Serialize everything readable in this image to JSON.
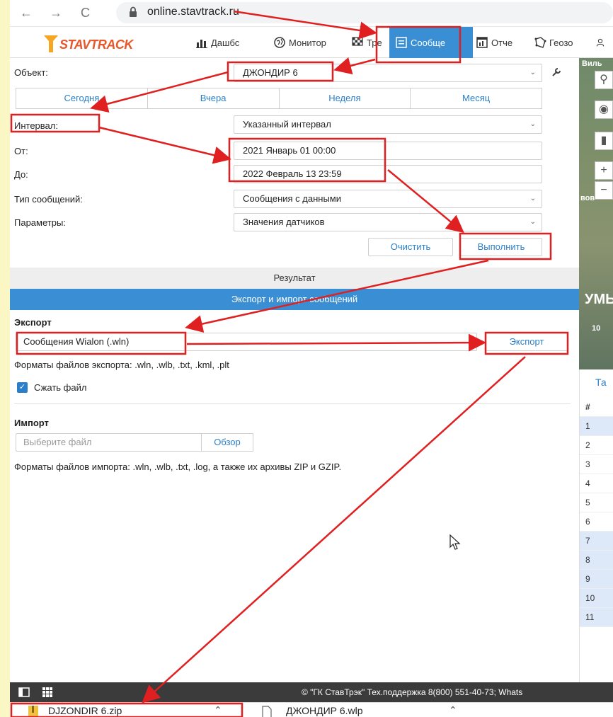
{
  "browser": {
    "url": "online.stavtrack.ru"
  },
  "app": {
    "logo_text": "STAVTRACK",
    "nav": [
      {
        "label": "Дашбс",
        "icon": "bar-chart-icon"
      },
      {
        "label": "Монитор",
        "icon": "globe-icon"
      },
      {
        "label": "Тре",
        "icon": "flag-icon"
      },
      {
        "label": "Сообще",
        "icon": "message-icon",
        "active": true
      },
      {
        "label": "Отче",
        "icon": "report-icon"
      },
      {
        "label": "Геозо",
        "icon": "geofence-icon"
      },
      {
        "label": "",
        "icon": "user-icon"
      }
    ]
  },
  "form": {
    "object_label": "Объект:",
    "object_value": "ДЖОНДИР 6",
    "tabs": [
      "Сегодня",
      "Вчера",
      "Неделя",
      "Месяц"
    ],
    "interval_label": "Интервал:",
    "interval_value": "Указанный интервал",
    "from_label": "От:",
    "from_value": "2021 Январь 01 00:00",
    "to_label": "До:",
    "to_value": "2022 Февраль 13 23:59",
    "msg_type_label": "Тип сообщений:",
    "msg_type_value": "Сообщения с данными",
    "params_label": "Параметры:",
    "params_value": "Значения датчиков",
    "clear_label": "Очистить",
    "execute_label": "Выполнить"
  },
  "results": {
    "title": "Результат",
    "export_import_title": "Экспорт и импорт сообщений"
  },
  "export": {
    "heading": "Экспорт",
    "format_value": "Сообщения Wialon (.wln)",
    "button": "Экспорт",
    "formats_hint": "Форматы файлов экспорта: .wln, .wlb, .txt, .kml, .plt",
    "compress_label": "Сжать файл"
  },
  "import": {
    "heading": "Импорт",
    "file_placeholder": "Выберите файл",
    "browse_button": "Обзор",
    "formats_hint": "Форматы файлов импорта: .wln, .wlb, .txt, .log, а также их архивы ZIP и GZIP."
  },
  "map": {
    "label_top": "Виль",
    "label_mid": "вов",
    "label_big": "УМЬ",
    "scale": "10"
  },
  "table": {
    "tab_label": "Та",
    "header": "#",
    "rows": [
      "1",
      "2",
      "3",
      "4",
      "5",
      "6",
      "7",
      "8",
      "9",
      "10",
      "11"
    ]
  },
  "footer": {
    "copyright": "© \"ГК СтавТрэк\" Тех.поддержка 8(800) 551-40-73; Whats"
  },
  "downloads": [
    {
      "name": "DJZONDIR 6.zip",
      "icon": "zip-file-icon"
    },
    {
      "name": "ДЖОНДИР 6.wlp",
      "icon": "file-icon"
    }
  ],
  "colors": {
    "accent": "#3a8fd4",
    "annotation": "#e02020",
    "background": "#fbf7c4"
  }
}
